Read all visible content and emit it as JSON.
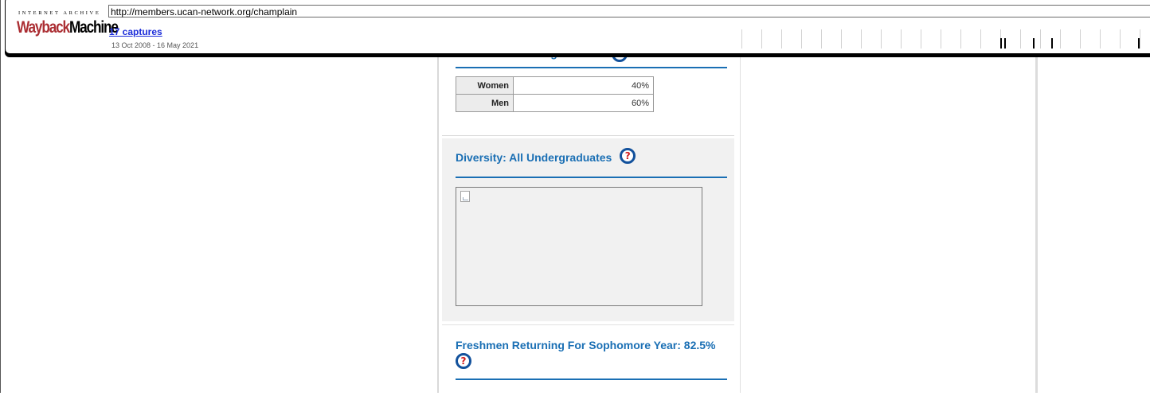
{
  "wayback": {
    "logo_top": "INTERNET ARCHIVE",
    "logo_way": "Wayback",
    "logo_machine": "Machine",
    "url": "http://members.ucan-network.org/champlain",
    "captures_label": "17 captures",
    "date_range": "13 Oct 2008 - 16 May 2021"
  },
  "gender": {
    "title": "Gender: All Undergraduates",
    "rows": [
      {
        "label": "Women",
        "value": "40%"
      },
      {
        "label": "Men",
        "value": "60%"
      }
    ]
  },
  "diversity": {
    "title": "Diversity: All Undergraduates"
  },
  "freshmen": {
    "title": "Freshmen Returning For Sophomore Year: 82.5%"
  },
  "help_icon_glyph": "?",
  "colors": {
    "title_blue": "#1a6fb4",
    "help_icon_blue": "#12519c",
    "help_mark_red": "#d11d1d",
    "wayback_red": "#ab2e33",
    "link_blue": "#1c2dd9"
  }
}
